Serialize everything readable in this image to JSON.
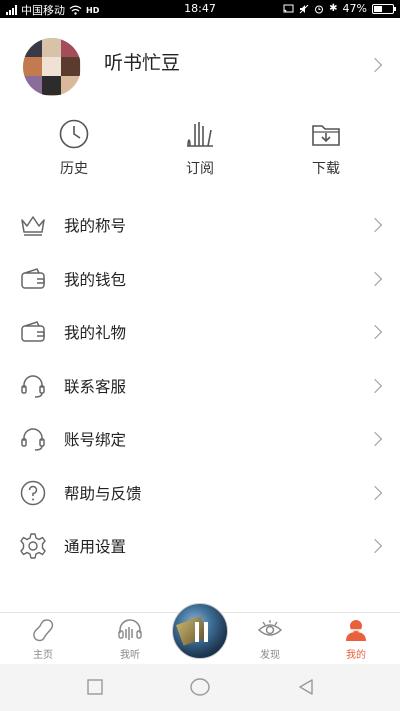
{
  "status_bar": {
    "carrier": "中国移动",
    "network": "HD",
    "time": "18:47",
    "battery": "47%",
    "battery_level": 0.47
  },
  "profile": {
    "username": "听书忙豆"
  },
  "quick_actions": [
    {
      "label": "历史",
      "icon": "clock-icon"
    },
    {
      "label": "订阅",
      "icon": "subscribe-icon"
    },
    {
      "label": "下载",
      "icon": "download-folder-icon"
    }
  ],
  "menu": [
    {
      "label": "我的称号",
      "icon": "crown-icon"
    },
    {
      "label": "我的钱包",
      "icon": "wallet-icon"
    },
    {
      "label": "我的礼物",
      "icon": "gift-wallet-icon"
    },
    {
      "label": "联系客服",
      "icon": "headset-icon"
    },
    {
      "label": "账号绑定",
      "icon": "headset-icon"
    },
    {
      "label": "帮助与反馈",
      "icon": "question-icon"
    },
    {
      "label": "通用设置",
      "icon": "gear-icon"
    }
  ],
  "tabs": [
    {
      "label": "主页",
      "icon": "bean-icon",
      "active": false
    },
    {
      "label": "我听",
      "icon": "headphones-icon",
      "active": false
    },
    {
      "label": "发现",
      "icon": "eye-icon",
      "active": false
    },
    {
      "label": "我的",
      "icon": "user-icon",
      "active": true
    }
  ],
  "colors": {
    "accent": "#e8603c",
    "icon_gray": "#777777",
    "text": "#222222"
  }
}
